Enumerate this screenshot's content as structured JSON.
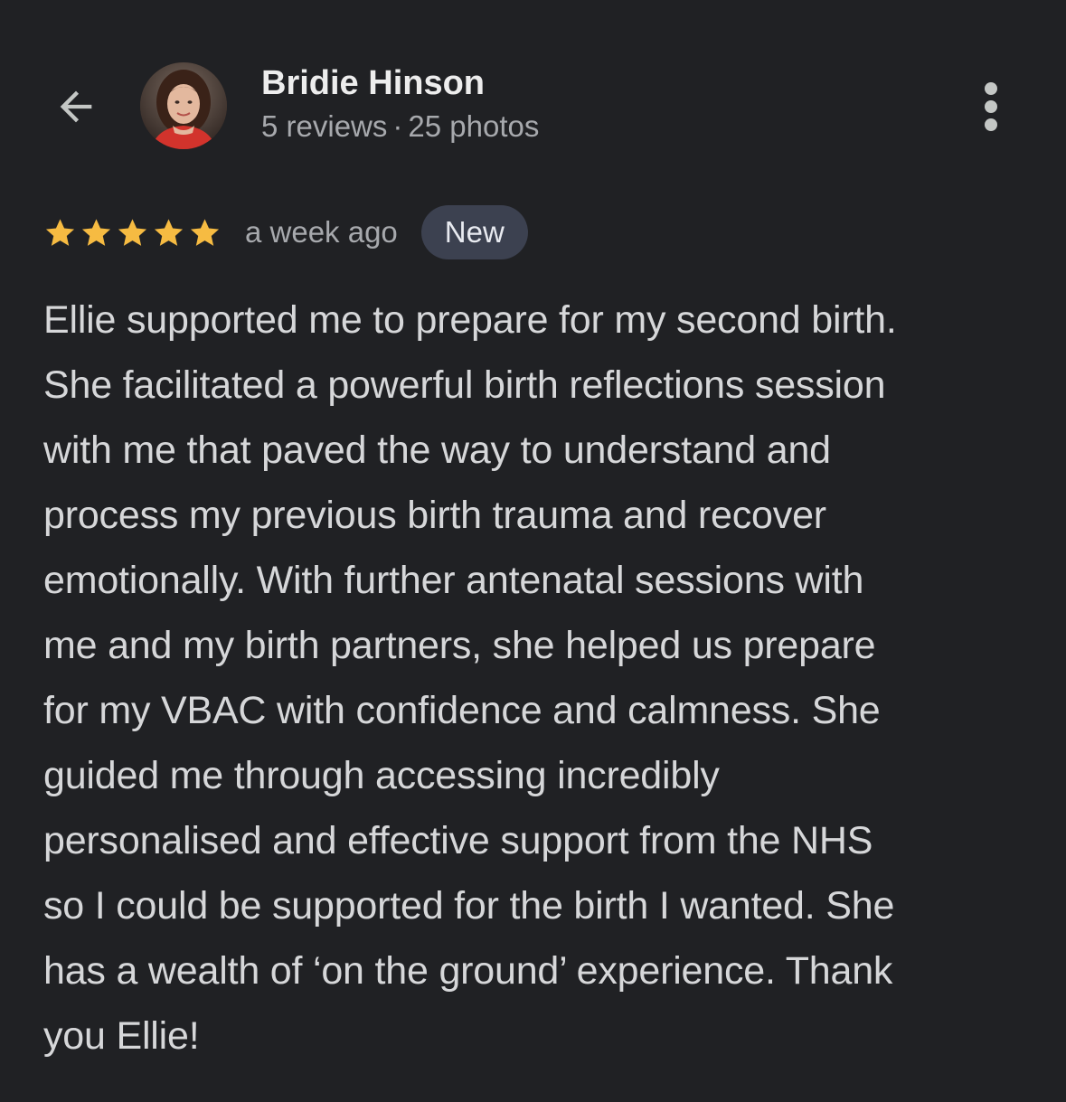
{
  "header": {
    "back_icon": "arrow-left-icon",
    "reviewer_name": "Bridie Hinson",
    "reviews_count": "5 reviews",
    "separator": "·",
    "photos_count": "25 photos",
    "more_icon": "more-vertical-icon"
  },
  "review": {
    "star_rating": 5,
    "star_color": "#f6bb42",
    "time_ago": "a week ago",
    "badge": "New",
    "text_lines": [
      "Ellie supported me to prepare for my second birth.",
      "She facilitated a powerful birth reflections session",
      "with me that paved the way to understand and",
      "process my previous birth trauma and recover",
      "emotionally. With further antenatal sessions with",
      "me and my birth partners, she helped us prepare",
      "for my VBAC with confidence and calmness. She",
      "guided me through accessing incredibly",
      "personalised and effective support from the NHS",
      "so I could be supported for the birth I wanted. She",
      "has a wealth of ‘on the ground’ experience. Thank",
      "you Ellie!"
    ]
  },
  "colors": {
    "background": "#202124",
    "badge_background": "#3c4150"
  }
}
